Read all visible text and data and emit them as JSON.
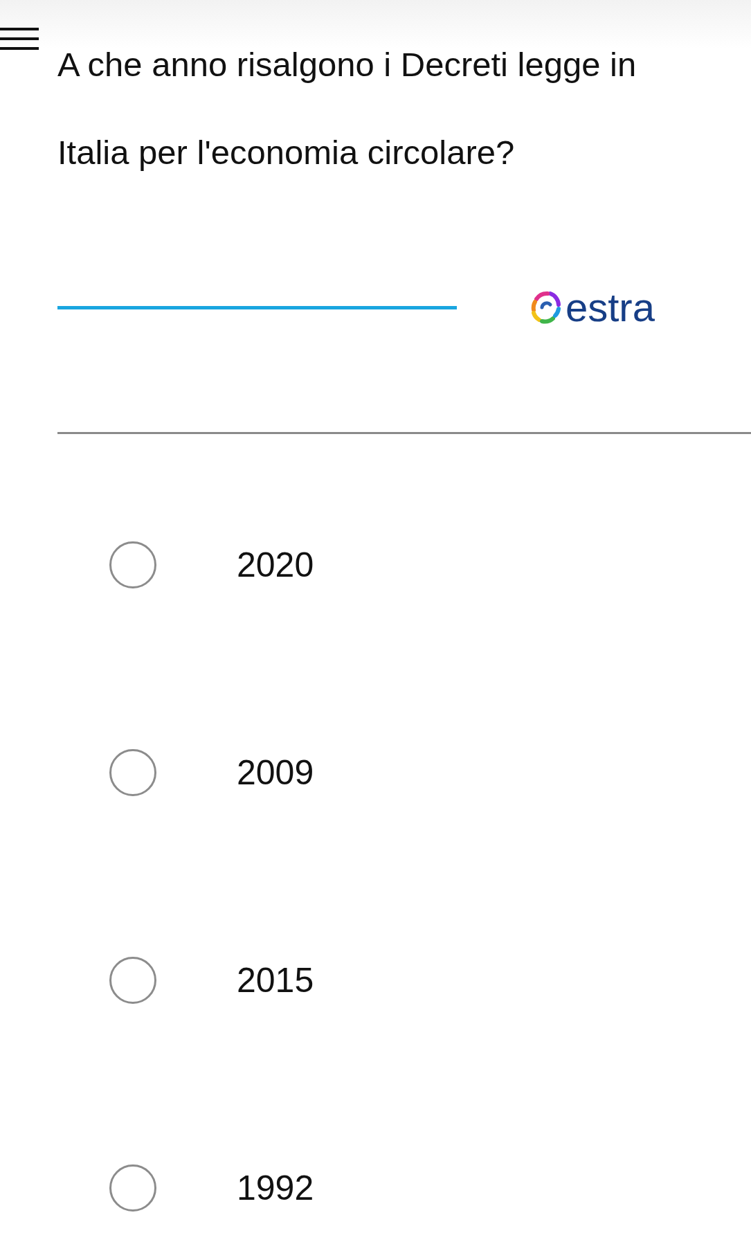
{
  "question": "A che anno risalgono i Decreti legge in Italia per l'economia circolare?",
  "logo": {
    "text": "estra"
  },
  "options": [
    {
      "label": "2020",
      "selected": false
    },
    {
      "label": "2009",
      "selected": false
    },
    {
      "label": "2015",
      "selected": false
    },
    {
      "label": "1992",
      "selected": false
    }
  ]
}
